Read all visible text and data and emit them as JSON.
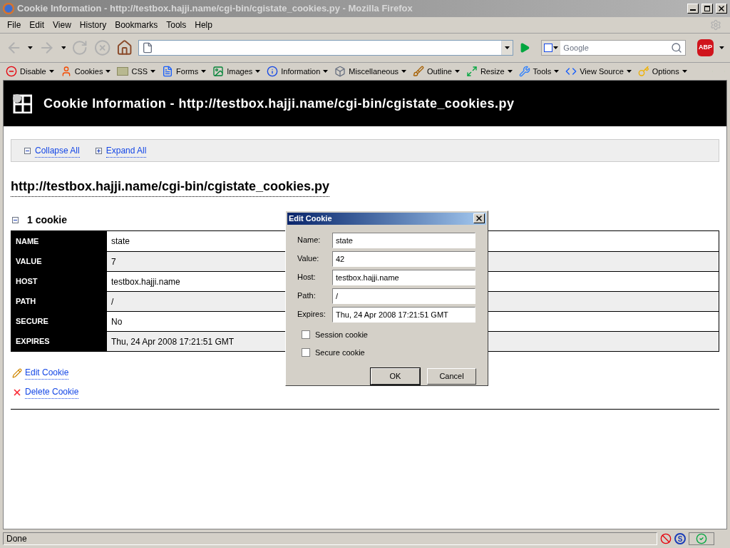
{
  "window": {
    "title": "Cookie Information - http://testbox.hajji.name/cgi-bin/cgistate_cookies.py - Mozilla Firefox"
  },
  "menu": [
    "File",
    "Edit",
    "View",
    "History",
    "Bookmarks",
    "Tools",
    "Help"
  ],
  "search": {
    "placeholder": "Google"
  },
  "adblock_label": "ABP",
  "dev_toolbar": [
    "Disable",
    "Cookies",
    "CSS",
    "Forms",
    "Images",
    "Information",
    "Miscellaneous",
    "Outline",
    "Resize",
    "Tools",
    "View Source",
    "Options"
  ],
  "page": {
    "header": "Cookie Information - http://testbox.hajji.name/cgi-bin/cgistate_cookies.py",
    "links": [
      "Collapse All",
      "Expand All"
    ],
    "url_heading": "http://testbox.hajji.name/cgi-bin/cgistate_cookies.py",
    "cookie_count": "1 cookie",
    "rows": [
      {
        "label": "NAME",
        "value": "state"
      },
      {
        "label": "VALUE",
        "value": "7"
      },
      {
        "label": "HOST",
        "value": "testbox.hajji.name"
      },
      {
        "label": "PATH",
        "value": "/"
      },
      {
        "label": "SECURE",
        "value": "No"
      },
      {
        "label": "EXPIRES",
        "value": "Thu, 24 Apr 2008 17:21:51 GMT"
      }
    ],
    "actions": [
      "Edit Cookie",
      "Delete Cookie"
    ]
  },
  "dialog": {
    "title": "Edit Cookie",
    "fields": [
      {
        "label": "Name:",
        "value": "state"
      },
      {
        "label": "Value:",
        "value": "42"
      },
      {
        "label": "Host:",
        "value": "testbox.hajji.name"
      },
      {
        "label": "Path:",
        "value": "/"
      },
      {
        "label": "Expires:",
        "value": "Thu, 24 Apr 2008 17:21:51 GMT"
      }
    ],
    "checkboxes": [
      {
        "label": "Session cookie",
        "checked": false
      },
      {
        "label": "Secure cookie",
        "checked": false
      }
    ],
    "buttons": [
      "OK",
      "Cancel"
    ]
  },
  "status_bar": {
    "text": "Done",
    "s_label": "S"
  }
}
